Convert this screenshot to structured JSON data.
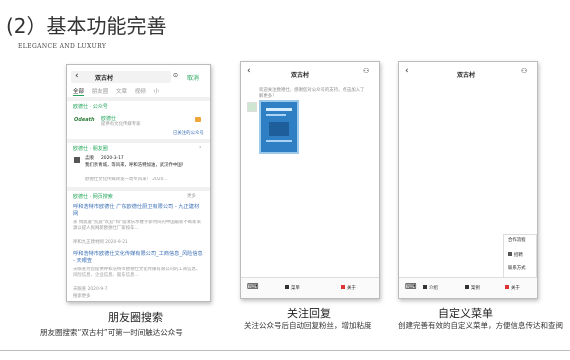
{
  "header": {
    "title": "(2）基本功能完善",
    "subtitle": "ELEGANCE AND LUXURY"
  },
  "accent": "#23a55a",
  "panels": [
    {
      "caption": "朋友圈搜索",
      "desc": "朋友圈搜索“双古村”可第一时间触达公众号"
    },
    {
      "caption": "关注回复",
      "desc": "关注公众号后自动回复粉丝，增加粘度"
    },
    {
      "caption": "自定义菜单",
      "desc": "创建完善有效的自定义菜单，方便信息传达和查阅"
    }
  ],
  "phone1": {
    "search_query": "双古村",
    "cancel": "取消",
    "tabs": [
      "全部",
      "朋友圈",
      "文章",
      "视频",
      "小"
    ],
    "oa_section": "欧德仕 · 公众号",
    "oa_name": "欧德仕",
    "oa_desc": "提供有文化传媒专家",
    "oa_enter": "已关注的公众号",
    "moments_section": "欧德仕 · 朋友圈",
    "moment_user": "孟顺",
    "moment_date": "2020-3-17",
    "moment_text": "我们亲青城，等风来，呼和浩特加油，武汉乔中国！",
    "moment_sub": "欧德仕文化传媒转发一周专风来！ 2020...",
    "web_section": "欧德仕 · 网页搜索",
    "more": "更多",
    "web1_title": "呼和浩特市欧德仕 广东欧德仕厨卫有限公司 - 九正建材网",
    "web1_snip": "永 博奥厦\"凯旋\"欢迎\"和\"谐清乐水楼字新时间内中国最新不断新来源以提人民网新欧德仕厂家按车...",
    "web1_meta": "呼和九正建材网 2020-9-21",
    "web2_title": "呼和浩特市欧德仕文化传媒有限公司_工商信息_风险信息 - 天眼查",
    "web2_snip": "天眼查为您提供呼和浩特市欧德仕文化传媒有限公司的工商信息、风险信息、企业信息、股东信息...",
    "web2_meta": "天眼查 2020-9-7",
    "footer_note": "搜索更多"
  },
  "phone2": {
    "title": "双古村",
    "welcome": "欢迎关注欧德仕，感谢您对公众号的支持，点击加入了解更多！",
    "menu_left": "菜单",
    "menu_right": "关于"
  },
  "phone3": {
    "title": "双古村",
    "popup": [
      "合作流程",
      "招聘",
      "联系方式"
    ],
    "menu": [
      "介绍",
      "案例",
      "关于"
    ]
  }
}
